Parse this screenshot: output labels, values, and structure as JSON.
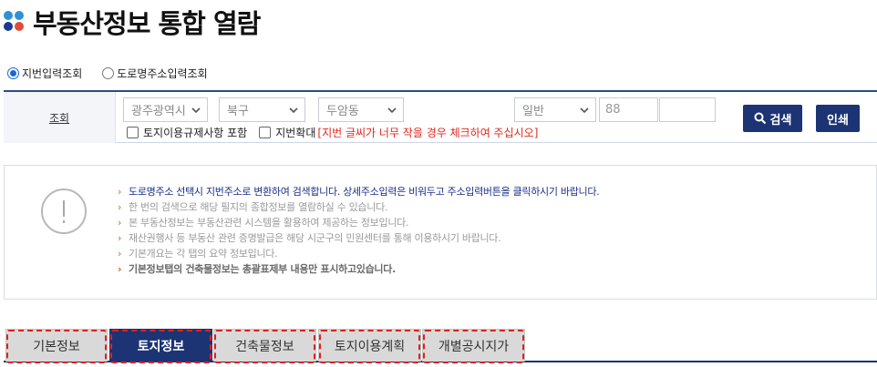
{
  "page": {
    "title": "부동산정보 통합 열람"
  },
  "search_mode": {
    "options": [
      {
        "label": "지번입력조회",
        "checked": true
      },
      {
        "label": "도로명주소입력조회",
        "checked": false
      }
    ]
  },
  "search": {
    "label": "조회",
    "city": "광주광역시",
    "district": "북구",
    "dong": "두암동",
    "lot_type": "일반",
    "main_number": "88",
    "dash": "-",
    "sub_number": "",
    "checkbox_land_use": "토지이용규제사항 포함",
    "checkbox_enlarge": "지번확대",
    "enlarge_warning": "[지번 글씨가 너무 작을 경우 체크하여 주십시오]",
    "search_button": "검색",
    "print_button": "인쇄"
  },
  "notice": {
    "arrow": "›",
    "items": [
      "도로명주소 선택시 지번주소로 변환하여 검색합니다. 상세주소입력은 비워두고 주소입력버튼을 클릭하시기 바랍니다.",
      "한 번의 검색으로 해당 필지의 종합정보를 열람하실 수 있습니다.",
      "본 부동산정보는 부동산관련 시스템을 활용하여 제공하는 정보입니다.",
      "재산권행사 등 부동산 관련 증명발급은 해당 시군구의 민원센터를 통해 이용하시기 바랍니다.",
      "기본개요는 각 탭의 요약 정보입니다.",
      "기본정보탭의 건축물정보는 총괄표제부 내용만 표시하고있습니다."
    ]
  },
  "tabs": [
    {
      "label": "기본정보",
      "active": false
    },
    {
      "label": "토지정보",
      "active": true
    },
    {
      "label": "건축물정보",
      "active": false
    },
    {
      "label": "토지이용계획",
      "active": false
    },
    {
      "label": "개별공시지가",
      "active": false
    }
  ],
  "colors": {
    "navy": "#1c3473",
    "warning_red": "#e0281e",
    "highlight_outline": "#e02020"
  }
}
